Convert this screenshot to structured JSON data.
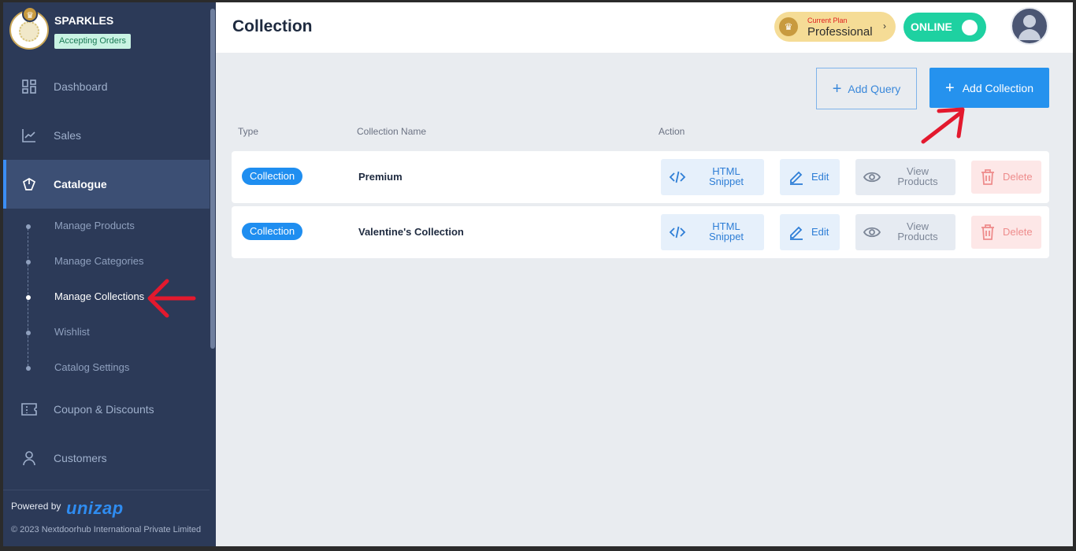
{
  "brand": {
    "name": "SPARKLES",
    "status": "Accepting Orders"
  },
  "sidebar": {
    "items": [
      {
        "label": "Dashboard",
        "icon": "dashboard-icon"
      },
      {
        "label": "Sales",
        "icon": "chart-line-icon"
      },
      {
        "label": "Catalogue",
        "icon": "tag-icon"
      },
      {
        "label": "Coupon & Discounts",
        "icon": "ticket-icon"
      },
      {
        "label": "Customers",
        "icon": "user-icon"
      }
    ],
    "catalogue_sub": [
      {
        "label": "Manage Products"
      },
      {
        "label": "Manage Categories"
      },
      {
        "label": "Manage Collections"
      },
      {
        "label": "Wishlist"
      },
      {
        "label": "Catalog Settings"
      }
    ],
    "powered_by": "Powered by",
    "powered_brand": "unizap",
    "copyright": "© 2023 Nextdoorhub International Private Limited"
  },
  "header": {
    "title": "Collection",
    "plan_caption": "Current Plan",
    "plan_name": "Professional",
    "online_label": "ONLINE"
  },
  "toolbar": {
    "add_query": "Add Query",
    "add_collection": "Add Collection"
  },
  "table": {
    "columns": [
      "Type",
      "Collection Name",
      "Action"
    ],
    "rows": [
      {
        "type": "Collection",
        "name": "Premium"
      },
      {
        "type": "Collection",
        "name": "Valentine's Collection"
      }
    ],
    "actions": {
      "html_1": "HTML",
      "html_2": "Snippet",
      "edit": "Edit",
      "view_1": "View",
      "view_2": "Products",
      "delete": "Delete"
    }
  },
  "colors": {
    "accent": "#2592ee",
    "sidebar": "#2c3a58",
    "online": "#1ed1a1",
    "annotation": "#e3192e"
  }
}
